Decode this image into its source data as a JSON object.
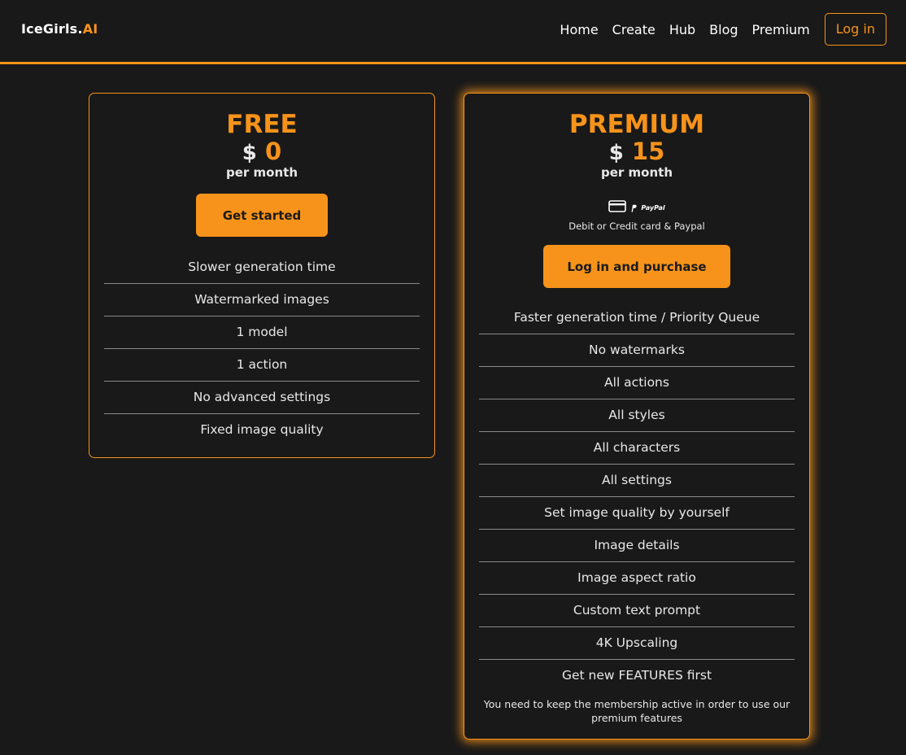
{
  "header": {
    "logo_main": "IceGirls.",
    "logo_accent": "AI",
    "nav": [
      "Home",
      "Create",
      "Hub",
      "Blog",
      "Premium"
    ],
    "login_label": "Log in"
  },
  "colors": {
    "accent": "#f7931a",
    "background": "#191919",
    "text": "#e8e8e8"
  },
  "plans": {
    "free": {
      "name": "FREE",
      "currency": "$",
      "amount": "0",
      "period": "per month",
      "button": "Get started",
      "features": [
        "Slower generation time",
        "Watermarked images",
        "1 model",
        "1 action",
        "No advanced settings",
        "Fixed image quality"
      ]
    },
    "premium": {
      "name": "PREMIUM",
      "currency": "$",
      "amount": "15",
      "period": "per month",
      "payment_icons": [
        "credit-card-icon",
        "paypal-icon"
      ],
      "paypal_text": "PayPal",
      "payment_label": "Debit or Credit card & Paypal",
      "button": "Log in and purchase",
      "features": [
        "Faster generation time / Priority Queue",
        "No watermarks",
        "All actions",
        "All styles",
        "All characters",
        "All settings",
        "Set image quality by yourself",
        "Image details",
        "Image aspect ratio",
        "Custom text prompt",
        "4K Upscaling",
        "Get new FEATURES first"
      ],
      "note": "You need to keep the membership active in order to use our premium features"
    }
  }
}
